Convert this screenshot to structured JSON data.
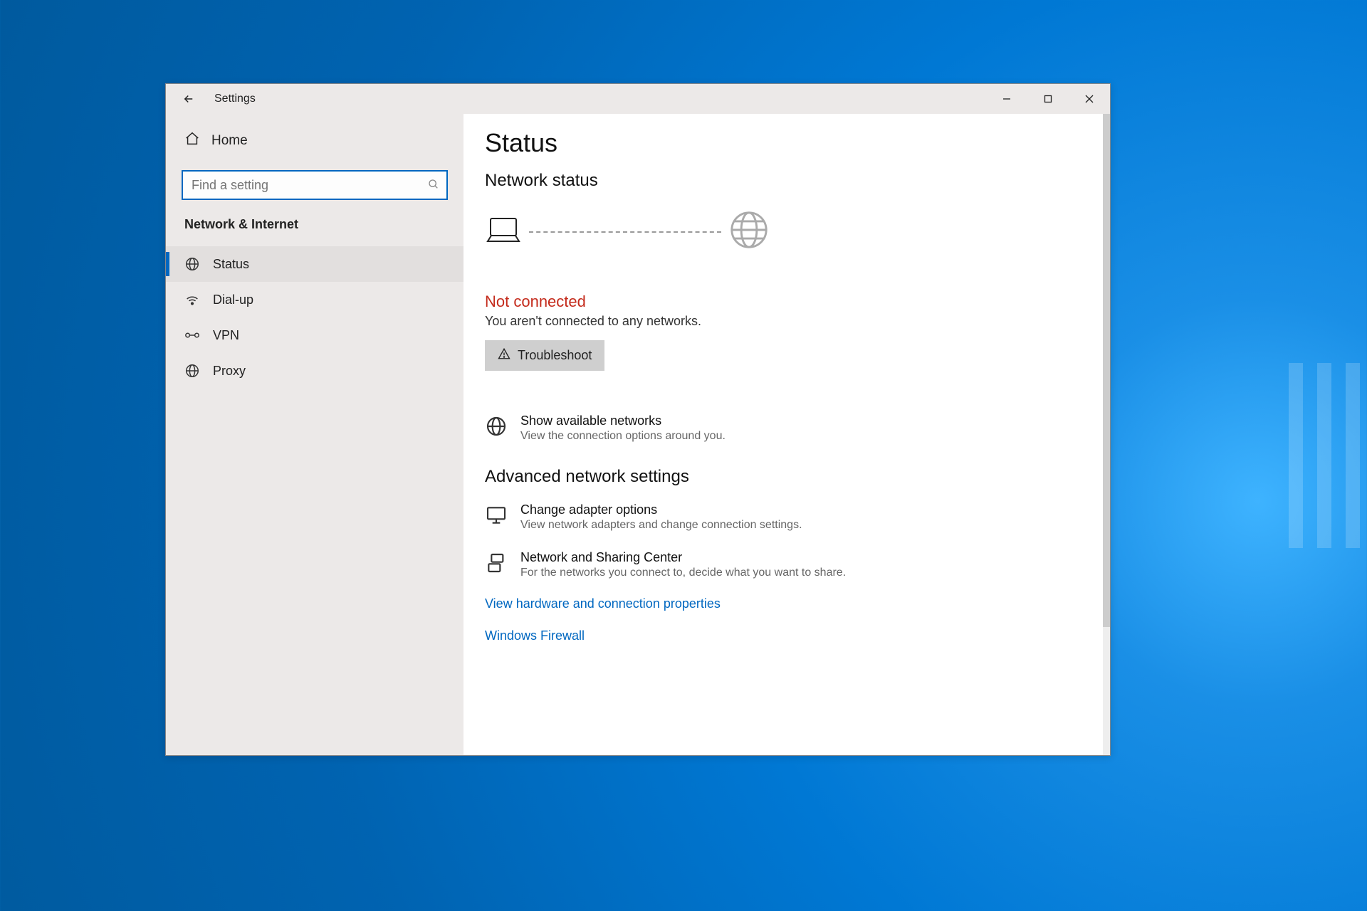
{
  "window": {
    "title": "Settings"
  },
  "sidebar": {
    "home": "Home",
    "search_placeholder": "Find a setting",
    "category": "Network & Internet",
    "items": [
      {
        "label": "Status"
      },
      {
        "label": "Dial-up"
      },
      {
        "label": "VPN"
      },
      {
        "label": "Proxy"
      }
    ]
  },
  "main": {
    "page_title": "Status",
    "network_status_heading": "Network status",
    "not_connected_title": "Not connected",
    "not_connected_sub": "You aren't connected to any networks.",
    "troubleshoot_label": "Troubleshoot",
    "show_networks": {
      "title": "Show available networks",
      "sub": "View the connection options around you."
    },
    "advanced_heading": "Advanced network settings",
    "adapter": {
      "title": "Change adapter options",
      "sub": "View network adapters and change connection settings."
    },
    "sharing": {
      "title": "Network and Sharing Center",
      "sub": "For the networks you connect to, decide what you want to share."
    },
    "link_hw": "View hardware and connection properties",
    "link_fw": "Windows Firewall"
  },
  "colors": {
    "accent": "#0067c0",
    "error": "#c42b1c"
  }
}
